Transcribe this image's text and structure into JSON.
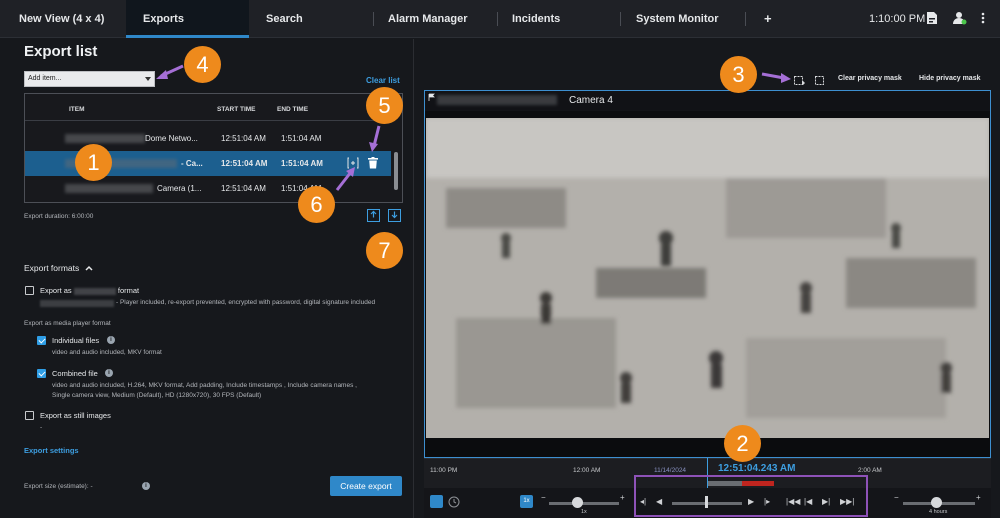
{
  "tabs": [
    {
      "label": "New View (4 x 4)"
    },
    {
      "label": "Exports"
    },
    {
      "label": "Search"
    },
    {
      "label": "Alarm Manager"
    },
    {
      "label": "Incidents"
    },
    {
      "label": "System Monitor"
    },
    {
      "label": "+"
    }
  ],
  "topbar": {
    "time": "1:10:00 PM"
  },
  "export_list": {
    "title": "Export list",
    "add_item_placeholder": "Add item...",
    "clear_list": "Clear list",
    "columns": [
      "ITEM",
      "START TIME",
      "END TIME"
    ],
    "rows": [
      {
        "item": "Dome Netwo...",
        "start": "12:51:04 AM",
        "end": "1:51:04 AM"
      },
      {
        "item": "- Ca...",
        "start": "12:51:04 AM",
        "end": "1:51:04 AM"
      },
      {
        "item": "Camera (1...",
        "start": "12:51:04 AM",
        "end": "1:51:04 AM"
      }
    ],
    "duration": "Export duration: 6:00:00"
  },
  "export_formats": {
    "title": "Export formats",
    "format_label_prefix": "Export as",
    "format_label_suffix": "format",
    "format_desc": "- Player included, re-export prevented, encrypted with password, digital signature included",
    "media_player_heading": "Export as media player format",
    "individual_label": "Individual files",
    "individual_desc": "video and audio included, MKV format",
    "combined_label": "Combined file",
    "combined_desc1": "video and audio included, H.264, MKV format, Add padding, Include timestamps , Include camera names   ,",
    "combined_desc2": "Single camera view, Medium (Default), HD (1280x720), 30 FPS (Default)",
    "still_label": "Export as still images",
    "still_desc": "-"
  },
  "export_settings": "Export settings",
  "export_size": "Export size (estimate): -",
  "create_export": "Create export",
  "privacy": {
    "clear": "Clear privacy mask",
    "hide": "Hide privacy mask"
  },
  "camera_name": "Camera 4",
  "timeline": {
    "labels": [
      "11:00 PM",
      "12:00 AM",
      "11/14/2024",
      "1:00 AM",
      "2:00 AM"
    ],
    "current": "12:51:04.243 AM"
  },
  "controls": {
    "speed": "1x",
    "speed_label": "1x",
    "range": "4 hours"
  },
  "badges": [
    "1",
    "2",
    "3",
    "4",
    "5",
    "6",
    "7"
  ],
  "colors": {
    "accent": "#2f88c9",
    "badge": "#ee8a1c",
    "annotation": "#8e52b8"
  }
}
